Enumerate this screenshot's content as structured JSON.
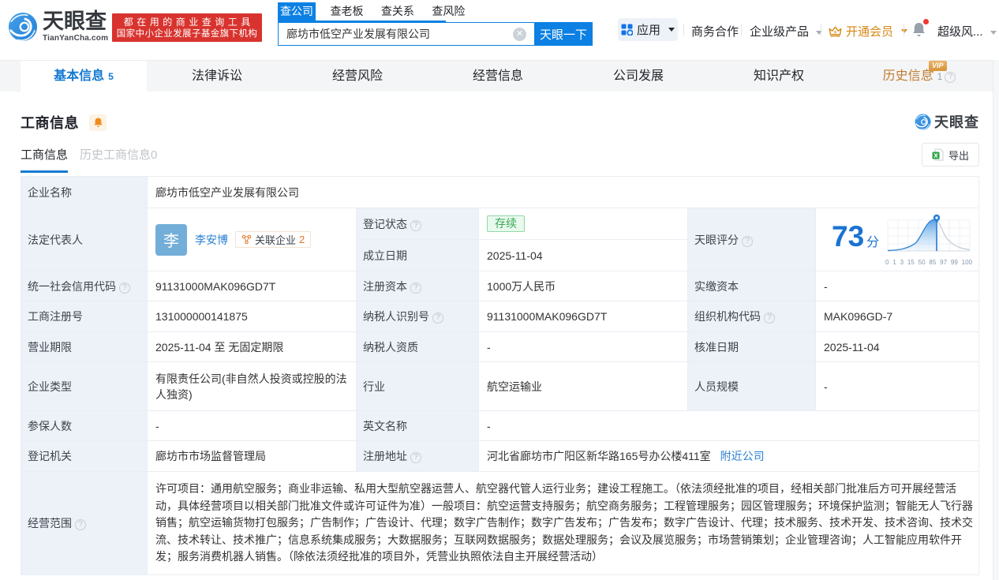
{
  "icons": {
    "clear": "✕",
    "help": "?"
  },
  "colors": {
    "brand_blue": "#0c80e3",
    "link_blue": "#2a80d2",
    "vip_orange": "#d68918",
    "status_green": "#37a854",
    "slogan_red": "#d8332e",
    "label_cell_bg": "#edf2f9"
  },
  "header": {
    "logo": {
      "brand": "天眼查",
      "domain": "TianYanCha.com"
    },
    "slogan": {
      "line1": "都在用的商业查询工具",
      "line2": "国家中小企业发展子基金旗下机构"
    },
    "search": {
      "tabs": [
        {
          "label": "查公司",
          "active": true
        },
        {
          "label": "查老板",
          "active": false
        },
        {
          "label": "查关系",
          "active": false
        },
        {
          "label": "查风险",
          "active": false
        }
      ],
      "input_value": "廊坊市低空产业发展有限公司",
      "button": "天眼一下"
    },
    "menu": {
      "apps": "应用",
      "business_cooperation": "商务合作",
      "enterprise_products": "企业级产品",
      "open_vip": "开通会员",
      "super_risk": "超级风..."
    }
  },
  "nav": {
    "tabs": [
      {
        "label": "基本信息",
        "count": "5",
        "active": true
      },
      {
        "label": "法律诉讼"
      },
      {
        "label": "经营风险"
      },
      {
        "label": "经营信息"
      },
      {
        "label": "公司发展"
      },
      {
        "label": "知识产权"
      },
      {
        "label": "历史信息",
        "count": "1",
        "badge": "VIP"
      }
    ]
  },
  "section": {
    "title": "工商信息",
    "watermark": "天眼查",
    "tabs": [
      {
        "label": "工商信息",
        "active": true
      },
      {
        "label": "历史工商信息0",
        "active": false
      }
    ],
    "export_label": "导出"
  },
  "table": {
    "r1": {
      "label": "企业名称",
      "value": "廊坊市低空产业发展有限公司"
    },
    "r2": {
      "label": "法定代表人",
      "avatar_char": "李",
      "person": "李安博",
      "related_label": "关联企业",
      "related_count": "2",
      "reg_status_label": "登记状态",
      "reg_status": "存续",
      "est_date_label": "成立日期",
      "est_date": "2025-11-04",
      "score_label": "天眼评分",
      "score": "73",
      "score_unit": "分"
    },
    "r3": {
      "c1l": "统一社会信用代码",
      "c1v": "91131000MAK096GD7T",
      "c2l": "注册资本",
      "c2v": "1000万人民币",
      "c3l": "实缴资本",
      "c3v": "-"
    },
    "r4": {
      "c1l": "工商注册号",
      "c1v": "131000000141875",
      "c2l": "纳税人识别号",
      "c2v": "91131000MAK096GD7T",
      "c3l": "组织机构代码",
      "c3v": "MAK096GD-7"
    },
    "r5": {
      "c1l": "营业期限",
      "c1v": "2025-11-04 至 无固定期限",
      "c2l": "纳税人资质",
      "c2v": "-",
      "c3l": "核准日期",
      "c3v": "2025-11-04"
    },
    "r6": {
      "c1l": "企业类型",
      "c1v": "有限责任公司(非自然人投资或控股的法人独资)",
      "c2l": "行业",
      "c2v": "航空运输业",
      "c3l": "人员规模",
      "c3v": "-"
    },
    "r7": {
      "c1l": "参保人数",
      "c1v": "-",
      "c2l": "英文名称",
      "c2v": "-"
    },
    "r8": {
      "c1l": "登记机关",
      "c1v": "廊坊市市场监督管理局",
      "c2l": "注册地址",
      "c2v": "河北省廊坊市广阳区新华路165号办公楼411室",
      "c2link": "附近公司"
    },
    "r9": {
      "label": "经营范围",
      "value": "许可项目：通用航空服务；商业非运输、私用大型航空器运营人、航空器代管人运行业务；建设工程施工。（依法须经批准的项目，经相关部门批准后方可开展经营活动，具体经营项目以相关部门批准文件或许可证件为准）一般项目：航空运营支持服务；航空商务服务；工程管理服务；园区管理服务；环境保护监测；智能无人飞行器销售；航空运输货物打包服务；广告制作；广告设计、代理；数字广告制作；数字广告发布；广告发布；数字广告设计、代理；技术服务、技术开发、技术咨询、技术交流、技术转让、技术推广；信息系统集成服务；大数据服务；互联网数据服务；数据处理服务；会议及展览服务；市场营销策划；企业管理咨询；人工智能应用软件开发；服务消费机器人销售。（除依法须经批准的项目外，凭营业执照依法自主开展经营活动）"
    }
  },
  "chart_data": {
    "type": "area",
    "title": "天眼评分分布曲线",
    "score": 73,
    "score_unit": "分",
    "x_ticks": [
      "0",
      "1",
      "3",
      "15",
      "50",
      "85",
      "97",
      "99",
      "100"
    ],
    "marker_position": 73,
    "legend_position": "none",
    "grid": true
  }
}
